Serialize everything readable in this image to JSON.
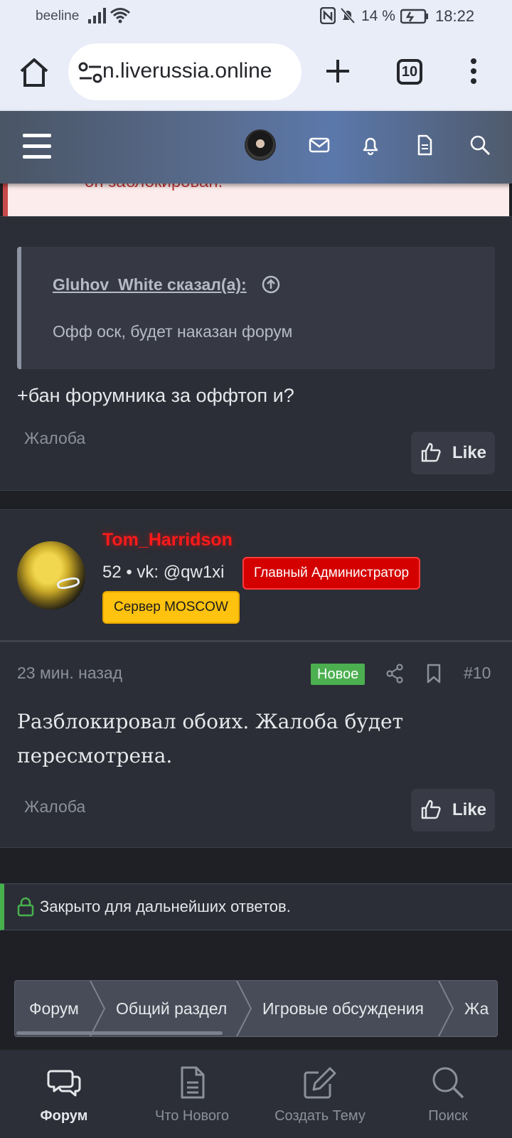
{
  "status_bar": {
    "carrier": "beeline",
    "battery": "14 %",
    "time": "18:22"
  },
  "browser": {
    "url": "n.liverussia.online",
    "tab_count": "10"
  },
  "notice": {
    "text": "он заблокирован."
  },
  "posts": [
    {
      "quote_author": "Gluhov_White сказал(а):",
      "quote_text": "Офф оск, будет наказан форум",
      "text": "+бан форумника за оффтоп и?",
      "report_label": "Жалоба",
      "like_label": "Like"
    },
    {
      "author": {
        "name": "Tom_Harridson",
        "meta": "52  •  vk: @qw1xi",
        "badge_admin": "Главный Администратор",
        "badge_server": "Сервер MOSCOW"
      },
      "time": "23 мин. назад",
      "new_badge": "Новое",
      "number": "#10",
      "text": "Разблокировал обоих. Жалоба будет пересмотрена.",
      "report_label": "Жалоба",
      "like_label": "Like"
    }
  ],
  "closed_notice": "Закрыто для дальнейших ответов.",
  "breadcrumb": [
    "Форум",
    "Общий раздел",
    "Игровые обсуждения",
    "Жа"
  ],
  "bottom_nav": [
    {
      "label": "Форум",
      "icon": "chat-bubbles-icon",
      "active": true
    },
    {
      "label": "Что Нового",
      "icon": "document-icon",
      "active": false
    },
    {
      "label": "Создать Тему",
      "icon": "edit-icon",
      "active": false
    },
    {
      "label": "Поиск",
      "icon": "search-icon",
      "active": false
    }
  ],
  "colors": {
    "username": "#ff1a1a",
    "admin_badge": "#d40000",
    "server_badge": "#ffc20e",
    "new_badge": "#4caf50",
    "closed_accent": "#47b14d"
  }
}
